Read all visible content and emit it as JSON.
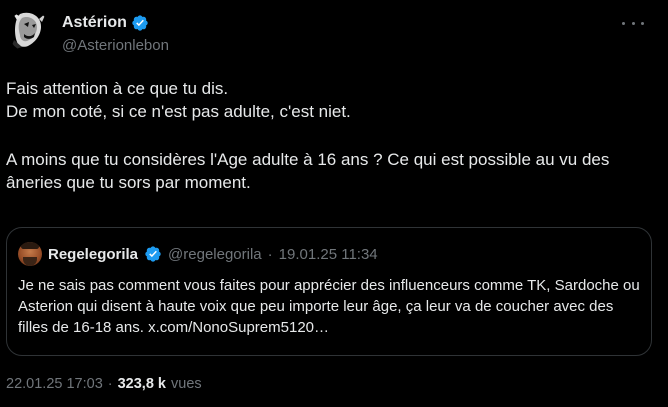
{
  "author": {
    "display_name": "Astérion",
    "handle": "@Asterionlebon",
    "verified": true
  },
  "tweet": {
    "lines": [
      "Fais attention à ce que tu dis.",
      "De mon coté, si ce n'est pas adulte, c'est niet.",
      "A moins que tu considères l'Age adulte à 16 ans ? Ce qui est possible au vu des âneries que tu sors par moment."
    ]
  },
  "quote": {
    "display_name": "Regelegorila",
    "handle": "@regelegorila",
    "separator": "·",
    "date": "19.01.25 11:34",
    "text": "Je ne sais pas comment vous faites pour apprécier des influenceurs comme TK, Sardoche ou Asterion qui disent à haute voix que peu importe leur âge, ça leur va de coucher avec des filles de 16-18 ans. x.com/NonoSuprem5120…"
  },
  "footer": {
    "timestamp": "22.01.25 17:03",
    "separator": "·",
    "views_count": "323,8 k",
    "views_label": "vues"
  },
  "colors": {
    "background": "#000000",
    "text": "#e7e9ea",
    "muted": "#71767b",
    "verified_blue": "#1d9bf0",
    "border": "#2f3336"
  }
}
